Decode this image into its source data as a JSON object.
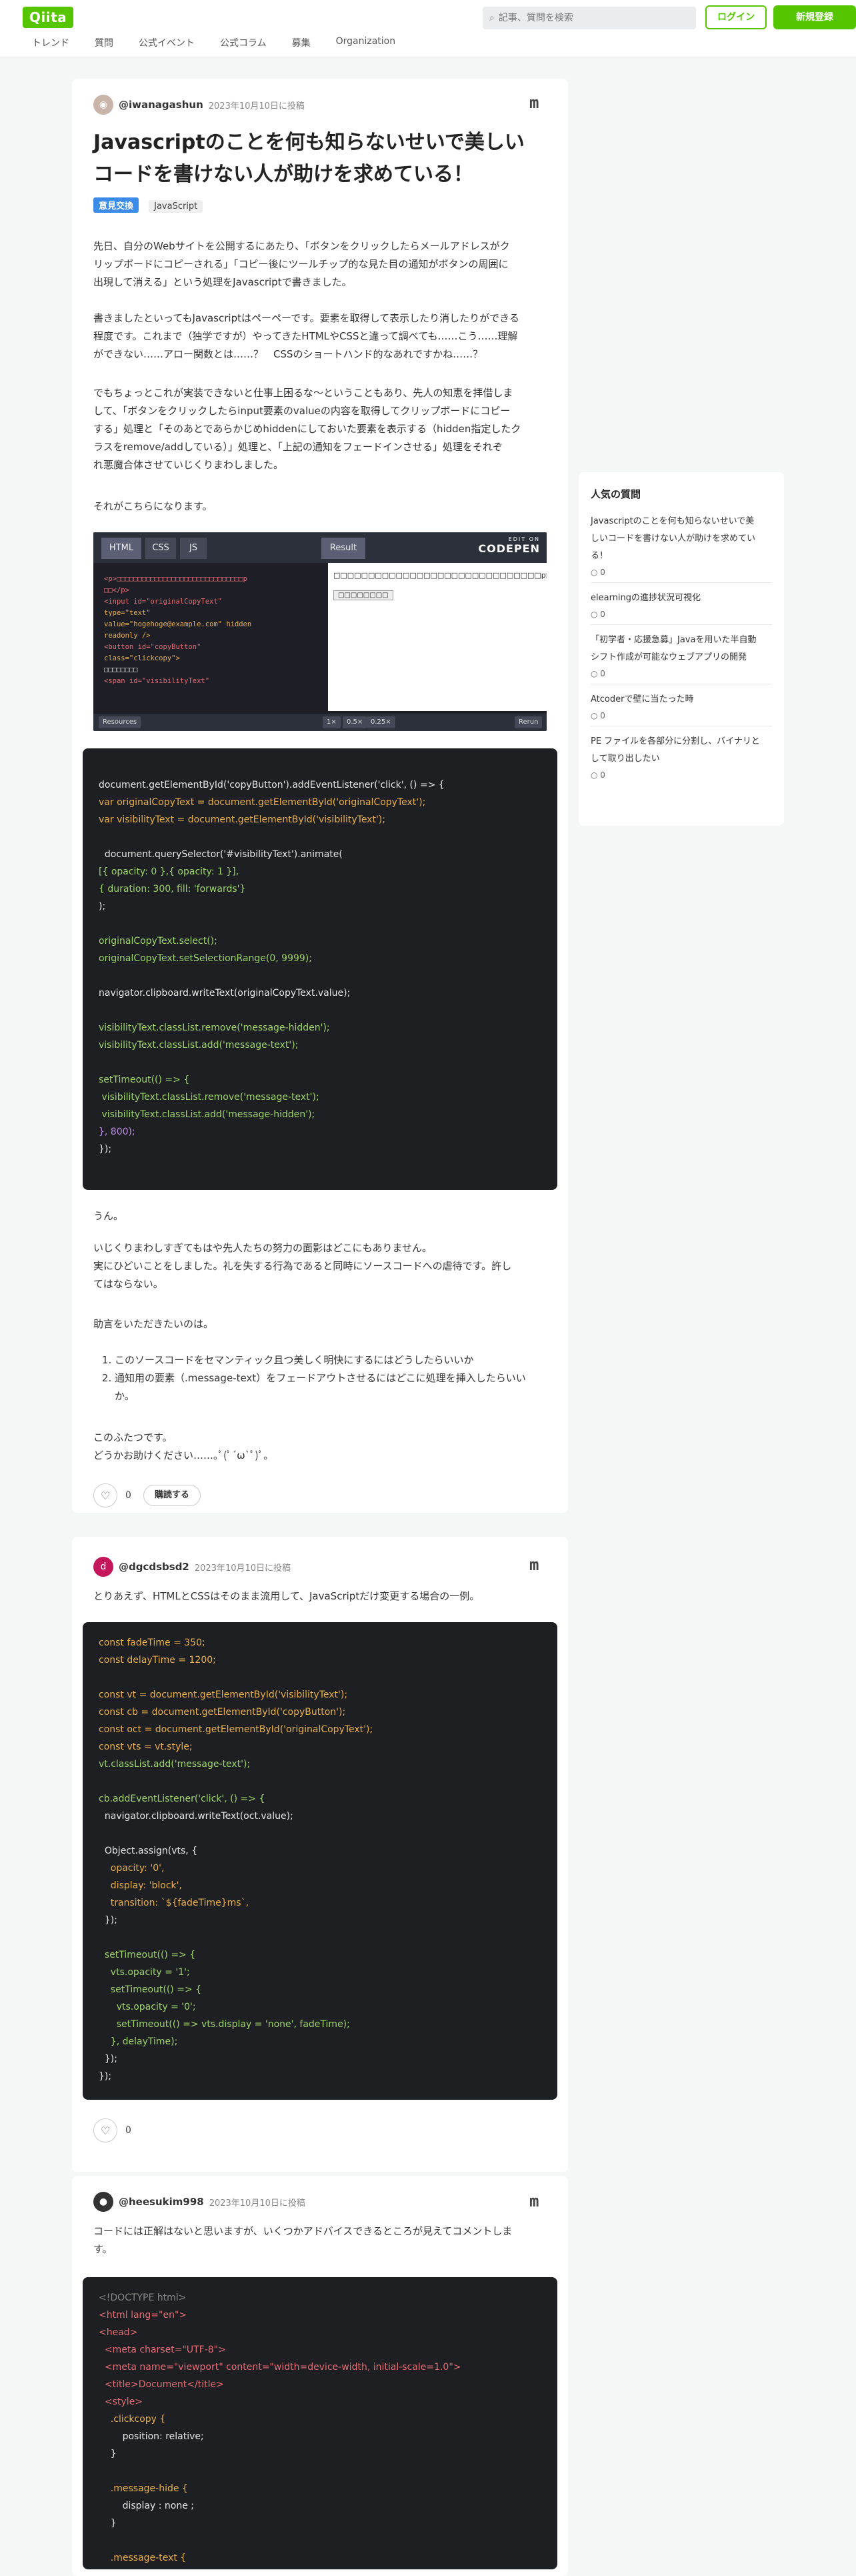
{
  "header": {
    "logo": "Qiita",
    "nav": [
      "トレンド",
      "質問",
      "公式イベント",
      "公式コラム",
      "募集",
      "Organization"
    ],
    "search_placeholder": "記事、質問を検索",
    "login": "ログイン",
    "signup": "新規登録"
  },
  "question": {
    "author": "@iwanagashun",
    "date": "2023年10月10日に投稿",
    "mark": "m",
    "title_line1": "Javascriptのことを何も知らないせいで美しい",
    "title_line2": "コードを書けない人が助けを求めている！",
    "tags": [
      "意見交換",
      "JavaScript"
    ],
    "p1": [
      "先日、自分のWebサイトを公開するにあたり、「ボタンをクリックしたらメールアドレスがク",
      "リップボードにコピーされる」「コピー後にツールチップ的な見た目の通知がボタンの周囲に",
      "出現して消える」という処理をJavascriptで書きました。"
    ],
    "p2": [
      "書きましたといってもJavascriptはペーペーです。要素を取得して表示したり消したりができる",
      "程度です。これまで（独学ですが）やってきたHTMLやCSSと違って調べても……こう……理解",
      "ができない……アロー関数とは……？　CSSのショートハンド的なあれですかね……？"
    ],
    "p3": [
      "でもちょっとこれが実装できないと仕事上困るな〜ということもあり、先人の知恵を拝借しま",
      "して、「ボタンをクリックしたらinput要素のvalueの内容を取得してクリップボードにコピー",
      "する」処理と「そのあとであらかじめhiddenにしておいた要素を表示する（hidden指定したク",
      "ラスをremove/addしている）」処理と、「上記の通知をフェードインさせる」処理をそれぞ",
      "れ悪魔合体させていじくりまわしました。"
    ],
    "p4": "それがこちらになります。",
    "codepen": {
      "tab_html": "HTML",
      "tab_css": "CSS",
      "tab_js": "JS",
      "tab_result": "Result",
      "brand_small": "EDIT ON",
      "brand": "CODEPEN",
      "code_lines": [
        "<p>□□□□□□□□□□□□□□□□□□□□□□□□□□□□□□p",
        "□□</p>",
        "<input id=\"originalCopyText\"",
        "type=\"text\"",
        "value=\"hogehoge@example.com\" hidden",
        "readonly />",
        "",
        "<button id=\"copyButton\"",
        "class=\"clickcopy\">",
        "  □□□□□□□□",
        "  <span id=\"visibilityText\""
      ],
      "result_text": "□□□□□□□□□□□□□□□□□□□□□□□□□□□□□□p□□",
      "result_button": "□□□□□□□□",
      "resources": "Resources",
      "zoom": [
        "1×",
        "0.5×",
        "0.25×"
      ],
      "rerun": "Rerun"
    },
    "code_lines": [
      "document.getElementById('copyButton').addEventListener('click', () => {",
      "var originalCopyText = document.getElementById('originalCopyText');",
      "var visibilityText = document.getElementById('visibilityText');",
      "",
      "  document.querySelector('#visibilityText').animate(",
      "[{ opacity: 0 },{ opacity: 1 }],",
      "{ duration: 300, fill: 'forwards'}",
      ");",
      "",
      "originalCopyText.select();",
      "originalCopyText.setSelectionRange(0, 9999);",
      "",
      "navigator.clipboard.writeText(originalCopyText.value);",
      "",
      "visibilityText.classList.remove('message-hidden');",
      "visibilityText.classList.add('message-text');",
      "",
      "setTimeout(() => {",
      " visibilityText.classList.remove('message-text');",
      " visibilityText.classList.add('message-hidden');",
      "}, 800);",
      "});"
    ],
    "p5": "うん。",
    "p6": [
      "いじくりまわしすぎてもはや先人たちの努力の面影はどこにもありません。",
      "実にひどいことをしました。礼を失する行為であると同時にソースコードへの虐待です。許し",
      "てはならない。"
    ],
    "p7": "助言をいただきたいのは。",
    "asks": [
      "このソースコードをセマンティック且つ美しく明快にするにはどうしたらいいか",
      "通知用の要素（.message-text）をフェードアウトさせるにはどこに処理を挿入したらいい"
    ],
    "asks_cont": "か。",
    "p8": [
      "このふたつです。",
      "どうかお助けください……｡ﾟ(ﾟ´ω`ﾟ)ﾟ｡"
    ],
    "likes": "0",
    "buy": "購読する"
  },
  "answer1": {
    "author": "@dgcdsbsd2",
    "date": "2023年10月10日に投稿",
    "mark": "m",
    "avatar_letter": "d",
    "text": "とりあえず、HTMLとCSSはそのまま流用して、JavaScriptだけ変更する場合の一例。",
    "likes": "0",
    "code_lines": [
      "const fadeTime = 350;",
      "const delayTime = 1200;",
      "",
      "const vt = document.getElementById('visibilityText');",
      "const cb = document.getElementById('copyButton');",
      "const oct = document.getElementById('originalCopyText');",
      "const vts = vt.style;",
      "vt.classList.add('message-text');",
      "",
      "cb.addEventListener('click', () => {",
      "  navigator.clipboard.writeText(oct.value);",
      "",
      "  Object.assign(vts, {",
      "    opacity: '0',",
      "    display: 'block',",
      "    transition: `${fadeTime}ms`,",
      "  });",
      "",
      "  setTimeout(() => {",
      "    vts.opacity = '1';",
      "    setTimeout(() => {",
      "      vts.opacity = '0';",
      "      setTimeout(() => vts.display = 'none', fadeTime);",
      "    }, delayTime);",
      "  });",
      "});"
    ]
  },
  "answer2": {
    "author": "@heesukim998",
    "date": "2023年10月10日に投稿",
    "mark": "m",
    "text": [
      "コードには正解はないと思いますが、いくつかアドバイスできるところが見えてコメントしま",
      "す。"
    ],
    "code_lines": [
      "<!DOCTYPE html>",
      "<html lang=\"en\">",
      "<head>",
      "  <meta charset=\"UTF-8\">",
      "  <meta name=\"viewport\" content=\"width=device-width, initial-scale=1.0\">",
      "  <title>Document</title>",
      "  <style>",
      "    .clickcopy {",
      "        position: relative;",
      "    }",
      "",
      "    .message-hide {",
      "        display : none ;",
      "    }",
      "",
      "    .message-text {"
    ]
  },
  "sidebar": {
    "title": "人気の質問",
    "items": [
      {
        "lines": [
          "Javascriptのことを何も知らないせいで美",
          "しいコードを書けない人が助けを求めてい",
          "る！"
        ],
        "count": "0"
      },
      {
        "lines": [
          "elearningの進捗状況可視化"
        ],
        "count": "0"
      },
      {
        "lines": [
          "「初学者・応援急募」Javaを用いた半自動",
          "シフト作成が可能なウェブアプリの開発"
        ],
        "count": "0"
      },
      {
        "lines": [
          "Atcoderで壁に当たった時"
        ],
        "count": "0"
      },
      {
        "lines": [
          "PE ファイルを各部分に分割し、バイナリと",
          "して取り出したい"
        ],
        "count": "0"
      }
    ]
  }
}
